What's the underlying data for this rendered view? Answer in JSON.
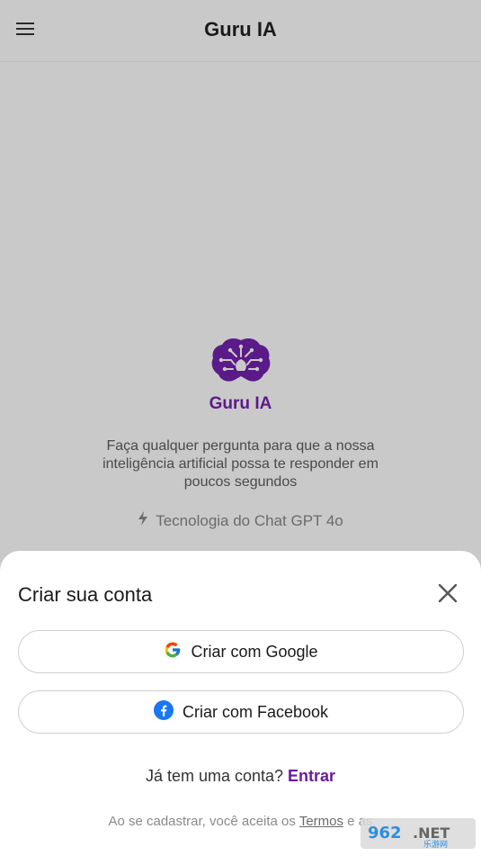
{
  "header": {
    "title": "Guru IA"
  },
  "hero": {
    "brand": "Guru IA",
    "description": "Faça qualquer pergunta para que a nossa inteligência artificial possa te responder em poucos segundos",
    "tech": "Tecnologia do Chat GPT 4o"
  },
  "sheet": {
    "title": "Criar sua conta",
    "google_label": "Criar com Google",
    "facebook_label": "Criar com Facebook",
    "login_prompt": "Já tem uma conta?",
    "login_link": "Entrar",
    "terms_prefix": "Ao se cadastrar, você aceita os",
    "terms_link": "Termos",
    "terms_suffix": "e as"
  },
  "colors": {
    "accent": "#6a1b9a",
    "overlay": "#c9c9c9",
    "facebook": "#1877f2"
  },
  "icons": {
    "menu": "hamburger-icon",
    "logo": "brain-circuit-logo",
    "tech": "bolt-icon",
    "close": "close-icon",
    "google": "google-icon",
    "facebook": "facebook-icon"
  }
}
